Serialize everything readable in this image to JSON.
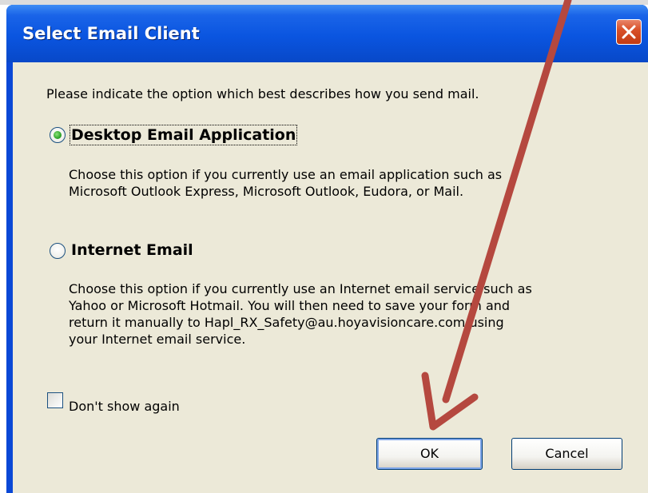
{
  "window": {
    "title": "Select Email Client"
  },
  "dialog": {
    "prompt": "Please indicate the option which best describes how you send mail.",
    "options": [
      {
        "label": "Desktop Email Application",
        "selected": true,
        "description": [
          "Choose this option if you currently use an email application such as",
          "Microsoft Outlook Express, Microsoft Outlook, Eudora, or Mail."
        ]
      },
      {
        "label": "Internet Email",
        "selected": false,
        "description": [
          "Choose this option if you currently use an Internet email service such as",
          "Yahoo or Microsoft Hotmail. You will then need to save your form and",
          "return it manually to Hapl_RX_Safety@au.hoyavisioncare.com using",
          "your Internet email service."
        ]
      }
    ],
    "dont_show_again": {
      "label": "Don't show again",
      "checked": false
    },
    "buttons": {
      "ok": "OK",
      "cancel": "Cancel"
    }
  },
  "colors": {
    "titlebar": "#0a55e0",
    "client_bg": "#ece9d8",
    "close_button": "#d9512a",
    "annotation_arrow": "#b5483f"
  },
  "icons": {
    "close": "close-icon",
    "annotation": "arrow-annotation"
  }
}
